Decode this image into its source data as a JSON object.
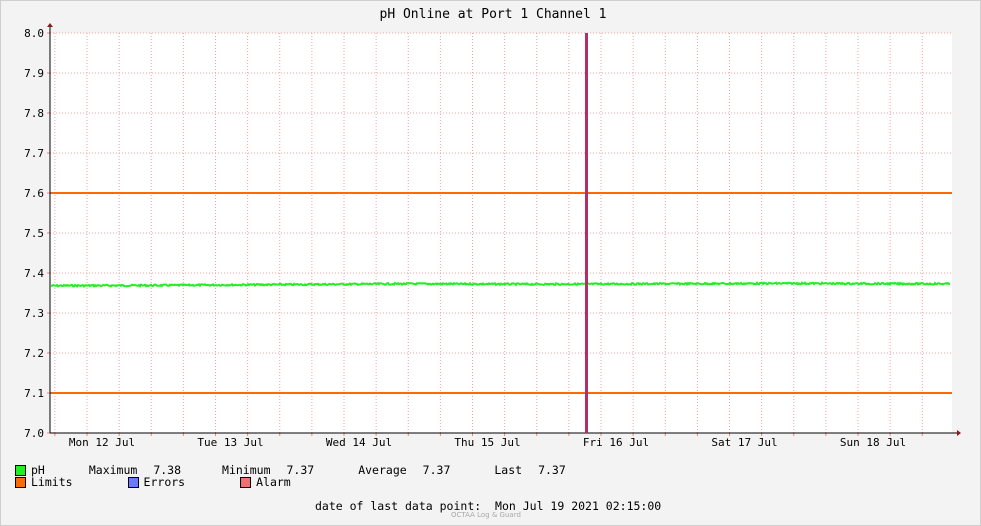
{
  "chart_data": {
    "type": "line",
    "title": "pH Online at Port 1 Channel 1",
    "ylim": [
      7.0,
      8.0
    ],
    "yticks": [
      "7.0",
      "7.1",
      "7.2",
      "7.3",
      "7.4",
      "7.5",
      "7.6",
      "7.7",
      "7.8",
      "7.9",
      "8.0"
    ],
    "x_day_labels": [
      "Mon 12 Jul",
      "Tue 13 Jul",
      "Wed 14 Jul",
      "Thu 15 Jul",
      "Fri 16 Jul",
      "Sat 17 Jul",
      "Sun 18 Jul"
    ],
    "grid": true,
    "series": [
      {
        "name": "pH",
        "color": "#22ee22",
        "x_dates": [
          "Mon 12 Jul",
          "Tue 13 Jul",
          "Wed 14 Jul",
          "Thu 15 Jul",
          "Fri 16 Jul",
          "Sat 17 Jul",
          "Sun 18 Jul",
          "Mon 19 Jul"
        ],
        "values": [
          7.368,
          7.369,
          7.371,
          7.373,
          7.372,
          7.373,
          7.374,
          7.373
        ]
      }
    ],
    "limits": {
      "color": "#ff6a00",
      "values": [
        7.1,
        7.6
      ]
    },
    "marker": {
      "color": "#b0306a",
      "date": "Fri 16 Jul"
    }
  },
  "legend": {
    "ph_label": "pH",
    "max_label": "Maximum",
    "max_value": "7.38",
    "min_label": "Minimum",
    "min_value": "7.37",
    "avg_label": "Average",
    "avg_value": "7.37",
    "last_label": "Last",
    "last_value": "7.37",
    "limits_label": "Limits",
    "errors_label": "Errors",
    "alarm_label": "Alarm",
    "colors": {
      "ph": "#22ee22",
      "limits": "#ff6a00",
      "errors": "#6a7bff",
      "alarm": "#f07070"
    }
  },
  "footer": {
    "last_point_label": "date of last data point:",
    "last_point_value": "Mon Jul 19 2021 02:15:00",
    "watermark": "OCTAA Log & Guard"
  }
}
